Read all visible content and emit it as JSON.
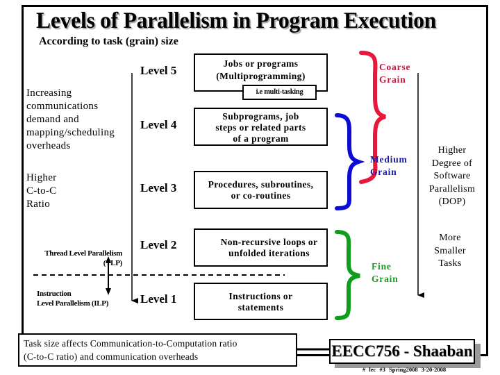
{
  "title": "Levels of Parallelism in Program Execution",
  "subtitle": "According to task (grain) size",
  "left_notes": {
    "overheads": "Increasing\ncommunications\ndemand and\nmapping/scheduling\noverheads",
    "ratio": "Higher\nC-to-C\nRatio",
    "tlp": "Thread Level Parallelism\n(TLP)",
    "ilp": "Instruction\nLevel Parallelism (ILP)"
  },
  "levels": [
    {
      "label": "Level 5",
      "lines": [
        "Jobs or programs",
        "(Multiprogramming)"
      ],
      "tag": "i.e multi-tasking"
    },
    {
      "label": "Level 4",
      "lines": [
        "Subprograms, job",
        "steps or related parts",
        "of a program"
      ]
    },
    {
      "label": "Level 3",
      "lines": [
        "Procedures, subroutines,",
        "or co-routines"
      ]
    },
    {
      "label": "Level 2",
      "lines": [
        "Non-recursive loops or",
        "unfolded iterations"
      ]
    },
    {
      "label": "Level 1",
      "lines": [
        "Instructions or",
        "statements"
      ]
    }
  ],
  "grains": [
    {
      "label": "Coarse\nGrain",
      "color": "#e8173c"
    },
    {
      "label": "Medium\nGrain",
      "color": "#0b0bd6"
    },
    {
      "label": "Fine\nGrain",
      "color": "#0f9e1c"
    }
  ],
  "right_notes": {
    "dop": "Higher\nDegree of\nSoftware\nParallelism\n(DOP)",
    "tasks": "More\nSmaller\nTasks"
  },
  "note": "Task size affects Communication-to-Computation ratio\n(C-to-C ratio) and communication overheads",
  "badge": "EECC756 - Shaaban",
  "footer": "#  lec #3  Spring2008  3-20-2008",
  "grain_text_colors": {
    "coarse": "#c8163c",
    "medium": "#1a1aa8",
    "fine": "#169a22"
  }
}
